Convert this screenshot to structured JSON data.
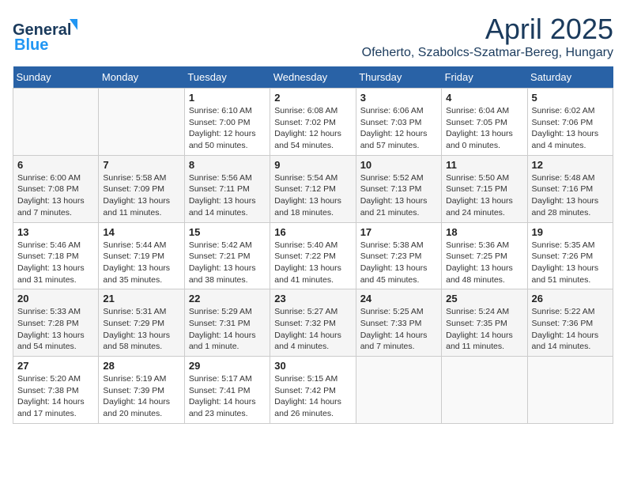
{
  "header": {
    "logo_general": "General",
    "logo_blue": "Blue",
    "title": "April 2025",
    "subtitle": "Ofeherto, Szabolcs-Szatmar-Bereg, Hungary"
  },
  "calendar": {
    "days_of_week": [
      "Sunday",
      "Monday",
      "Tuesday",
      "Wednesday",
      "Thursday",
      "Friday",
      "Saturday"
    ],
    "weeks": [
      [
        {
          "day": "",
          "detail": ""
        },
        {
          "day": "",
          "detail": ""
        },
        {
          "day": "1",
          "detail": "Sunrise: 6:10 AM\nSunset: 7:00 PM\nDaylight: 12 hours\nand 50 minutes."
        },
        {
          "day": "2",
          "detail": "Sunrise: 6:08 AM\nSunset: 7:02 PM\nDaylight: 12 hours\nand 54 minutes."
        },
        {
          "day": "3",
          "detail": "Sunrise: 6:06 AM\nSunset: 7:03 PM\nDaylight: 12 hours\nand 57 minutes."
        },
        {
          "day": "4",
          "detail": "Sunrise: 6:04 AM\nSunset: 7:05 PM\nDaylight: 13 hours\nand 0 minutes."
        },
        {
          "day": "5",
          "detail": "Sunrise: 6:02 AM\nSunset: 7:06 PM\nDaylight: 13 hours\nand 4 minutes."
        }
      ],
      [
        {
          "day": "6",
          "detail": "Sunrise: 6:00 AM\nSunset: 7:08 PM\nDaylight: 13 hours\nand 7 minutes."
        },
        {
          "day": "7",
          "detail": "Sunrise: 5:58 AM\nSunset: 7:09 PM\nDaylight: 13 hours\nand 11 minutes."
        },
        {
          "day": "8",
          "detail": "Sunrise: 5:56 AM\nSunset: 7:11 PM\nDaylight: 13 hours\nand 14 minutes."
        },
        {
          "day": "9",
          "detail": "Sunrise: 5:54 AM\nSunset: 7:12 PM\nDaylight: 13 hours\nand 18 minutes."
        },
        {
          "day": "10",
          "detail": "Sunrise: 5:52 AM\nSunset: 7:13 PM\nDaylight: 13 hours\nand 21 minutes."
        },
        {
          "day": "11",
          "detail": "Sunrise: 5:50 AM\nSunset: 7:15 PM\nDaylight: 13 hours\nand 24 minutes."
        },
        {
          "day": "12",
          "detail": "Sunrise: 5:48 AM\nSunset: 7:16 PM\nDaylight: 13 hours\nand 28 minutes."
        }
      ],
      [
        {
          "day": "13",
          "detail": "Sunrise: 5:46 AM\nSunset: 7:18 PM\nDaylight: 13 hours\nand 31 minutes."
        },
        {
          "day": "14",
          "detail": "Sunrise: 5:44 AM\nSunset: 7:19 PM\nDaylight: 13 hours\nand 35 minutes."
        },
        {
          "day": "15",
          "detail": "Sunrise: 5:42 AM\nSunset: 7:21 PM\nDaylight: 13 hours\nand 38 minutes."
        },
        {
          "day": "16",
          "detail": "Sunrise: 5:40 AM\nSunset: 7:22 PM\nDaylight: 13 hours\nand 41 minutes."
        },
        {
          "day": "17",
          "detail": "Sunrise: 5:38 AM\nSunset: 7:23 PM\nDaylight: 13 hours\nand 45 minutes."
        },
        {
          "day": "18",
          "detail": "Sunrise: 5:36 AM\nSunset: 7:25 PM\nDaylight: 13 hours\nand 48 minutes."
        },
        {
          "day": "19",
          "detail": "Sunrise: 5:35 AM\nSunset: 7:26 PM\nDaylight: 13 hours\nand 51 minutes."
        }
      ],
      [
        {
          "day": "20",
          "detail": "Sunrise: 5:33 AM\nSunset: 7:28 PM\nDaylight: 13 hours\nand 54 minutes."
        },
        {
          "day": "21",
          "detail": "Sunrise: 5:31 AM\nSunset: 7:29 PM\nDaylight: 13 hours\nand 58 minutes."
        },
        {
          "day": "22",
          "detail": "Sunrise: 5:29 AM\nSunset: 7:31 PM\nDaylight: 14 hours\nand 1 minute."
        },
        {
          "day": "23",
          "detail": "Sunrise: 5:27 AM\nSunset: 7:32 PM\nDaylight: 14 hours\nand 4 minutes."
        },
        {
          "day": "24",
          "detail": "Sunrise: 5:25 AM\nSunset: 7:33 PM\nDaylight: 14 hours\nand 7 minutes."
        },
        {
          "day": "25",
          "detail": "Sunrise: 5:24 AM\nSunset: 7:35 PM\nDaylight: 14 hours\nand 11 minutes."
        },
        {
          "day": "26",
          "detail": "Sunrise: 5:22 AM\nSunset: 7:36 PM\nDaylight: 14 hours\nand 14 minutes."
        }
      ],
      [
        {
          "day": "27",
          "detail": "Sunrise: 5:20 AM\nSunset: 7:38 PM\nDaylight: 14 hours\nand 17 minutes."
        },
        {
          "day": "28",
          "detail": "Sunrise: 5:19 AM\nSunset: 7:39 PM\nDaylight: 14 hours\nand 20 minutes."
        },
        {
          "day": "29",
          "detail": "Sunrise: 5:17 AM\nSunset: 7:41 PM\nDaylight: 14 hours\nand 23 minutes."
        },
        {
          "day": "30",
          "detail": "Sunrise: 5:15 AM\nSunset: 7:42 PM\nDaylight: 14 hours\nand 26 minutes."
        },
        {
          "day": "",
          "detail": ""
        },
        {
          "day": "",
          "detail": ""
        },
        {
          "day": "",
          "detail": ""
        }
      ]
    ]
  }
}
